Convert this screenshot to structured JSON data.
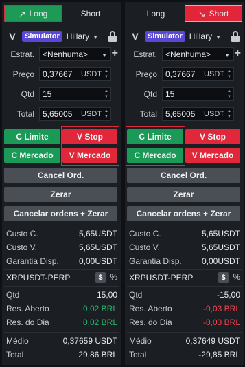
{
  "panels": [
    {
      "tabs": [
        {
          "label": "Long",
          "icon": "arrow-up-right-icon",
          "active": true
        },
        {
          "label": "Short",
          "active": false
        }
      ],
      "account": {
        "logo": "V",
        "badge": "Simulator",
        "user": "Hillary"
      },
      "form": {
        "strategy_label": "Estrat.",
        "strategy_value": "<Nenhuma>",
        "price_label": "Preço",
        "price_value": "0,37667",
        "price_unit": "USDT",
        "qty_label": "Qtd",
        "qty_value": "15",
        "total_label": "Total",
        "total_value": "5,65005",
        "total_unit": "USDT"
      },
      "buttons": {
        "limit_buy": "C Limite",
        "stop_sell": "V Stop",
        "market_buy": "C Mercado",
        "market_sell": "V Mercado",
        "cancel": "Cancel Ord.",
        "flatten": "Zerar",
        "cancel_flatten": "Cancelar ordens + Zerar"
      },
      "summary": [
        {
          "label": "Custo C.",
          "value": "5,65",
          "unit": "USDT"
        },
        {
          "label": "Custo V.",
          "value": "5,65",
          "unit": "USDT"
        },
        {
          "label": "Garantia Disp.",
          "value": "0,00",
          "unit": "USDT"
        }
      ],
      "symbol": "XRPUSDT-PERP",
      "dollar": "$",
      "percent": "%",
      "position": [
        {
          "label": "Qtd",
          "value": "15,00",
          "tone": "neutral"
        },
        {
          "label": "Res. Aberto",
          "value": "0,02 BRL",
          "tone": "pos"
        },
        {
          "label": "Res. do Dia",
          "value": "0,02 BRL",
          "tone": "pos"
        }
      ],
      "totals": [
        {
          "label": "Médio",
          "value": "0,37659 USDT"
        },
        {
          "label": "Total",
          "value": "29,86 BRL"
        }
      ]
    },
    {
      "tabs": [
        {
          "label": "Long",
          "active": false
        },
        {
          "label": "Short",
          "icon": "arrow-down-right-icon",
          "active": true
        }
      ],
      "account": {
        "logo": "V",
        "badge": "Simulator",
        "user": "Hillary"
      },
      "form": {
        "strategy_label": "Estrat.",
        "strategy_value": "<Nenhuma>",
        "price_label": "Preço",
        "price_value": "0,37667",
        "price_unit": "USDT",
        "qty_label": "Qtd",
        "qty_value": "15",
        "total_label": "Total",
        "total_value": "5,65005",
        "total_unit": "USDT"
      },
      "buttons": {
        "limit_buy": "C Limite",
        "stop_sell": "V Stop",
        "market_buy": "C Mercado",
        "market_sell": "V Mercado",
        "cancel": "Cancel Ord.",
        "flatten": "Zerar",
        "cancel_flatten": "Cancelar ordens + Zerar"
      },
      "summary": [
        {
          "label": "Custo C.",
          "value": "5,65",
          "unit": "USDT"
        },
        {
          "label": "Custo V.",
          "value": "5,65",
          "unit": "USDT"
        },
        {
          "label": "Garantia Disp.",
          "value": "0,00",
          "unit": "USDT"
        }
      ],
      "symbol": "XRPUSDT-PERP",
      "dollar": "$",
      "percent": "%",
      "position": [
        {
          "label": "Qtd",
          "value": "-15,00",
          "tone": "neutral"
        },
        {
          "label": "Res. Aberto",
          "value": "-0,03 BRL",
          "tone": "neg"
        },
        {
          "label": "Res. do Dia",
          "value": "-0,03 BRL",
          "tone": "neg"
        }
      ],
      "totals": [
        {
          "label": "Médio",
          "value": "0,37649 USDT"
        },
        {
          "label": "Total",
          "value": "-29,85 BRL"
        }
      ]
    }
  ],
  "colors": {
    "buy": "#1a9a56",
    "sell": "#e0283a",
    "accent": "#5a47d6",
    "positive": "#21b36a",
    "negative": "#f0414f"
  }
}
